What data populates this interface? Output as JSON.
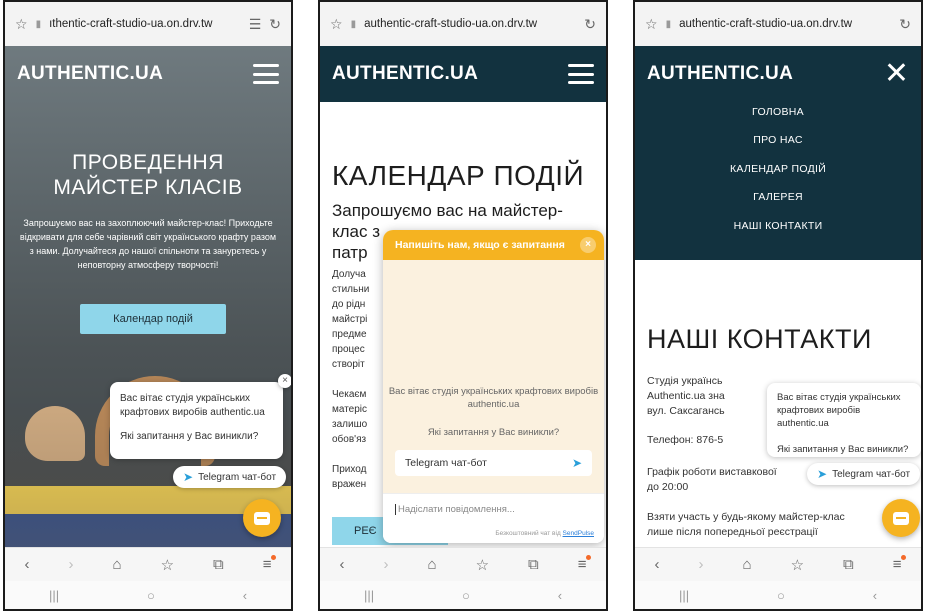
{
  "browser": {
    "url_p1": "ıthentic-craft-studio-ua.on.drv.tw",
    "url": "authentic-craft-studio-ua.on.drv.tw"
  },
  "site": {
    "logo": "AUTHENTIC.UA"
  },
  "hero": {
    "title_line1": "ПРОВЕДЕННЯ",
    "title_line2": "МАЙСТЕР КЛАСІВ",
    "text": "Запрошуємо вас на захоплюючий майстер-клас! Приходьте відкривати для себе чарівний світ українського крафту разом з нами. Долучайтеся до нашої спільноти та занурєтесь у неповторну атмосферу творчості!",
    "button": "Календар подій"
  },
  "bot": {
    "greeting": "Вас вітає студія українських крафтових виробів authentic.ua",
    "question": "Які запитання у Вас виникли?",
    "telegram": "Telegram чат-бот",
    "close": "×"
  },
  "events": {
    "title": "КАЛЕНДАР ПОДІЙ",
    "subtitle_1": "Запрошуємо вас на майстер-",
    "subtitle_2": "клас з",
    "subtitle_3": "патр",
    "body": [
      "Долуча",
      "стильни",
      "до рідн",
      "майстрі",
      "предме",
      "процес",
      "створіт",
      "",
      "Чекаєм",
      "матеріс",
      "залишо",
      "обов'яз",
      "",
      "Приход",
      "вражен"
    ],
    "button": "РЕЄ"
  },
  "chat": {
    "header": "Напишіть нам, якщо є запитання",
    "close": "×",
    "placeholder": "Надіслати повідомлення...",
    "powered_prefix": "Безкоштовний чат від ",
    "powered_link": "SendPulse"
  },
  "menu": {
    "items": [
      "ГОЛОВНА",
      "ПРО НАС",
      "КАЛЕНДАР ПОДІЙ",
      "ГАЛЕРЕЯ",
      "НАШІ КОНТАКТИ"
    ]
  },
  "contacts": {
    "title": "НАШІ КОНТАКТИ",
    "line1": "Студія українсь",
    "line2": "Authentic.ua зна",
    "line3": "вул. Саксагансь",
    "phone": "Телефон: 876-5",
    "hours1": "Графік роботи виставкової",
    "hours2": "до 20:00",
    "join1": "Взяти участь у будь-якому майстер-клас",
    "join2": "лише після попередньої реєстрації"
  },
  "icons": {
    "star": "☆",
    "lock": "▮",
    "reload": "↻",
    "reader": "☰",
    "back": "‹",
    "forward": "›",
    "home": "⌂",
    "bookmark": "☆",
    "tabs": "⧉",
    "menu": "≡",
    "sys_recent": "|||",
    "sys_home": "○",
    "sys_back": "‹",
    "send": "➤"
  },
  "colors": {
    "brand_dark": "#12323f",
    "accent_blue": "#8fd6ea",
    "chat_orange": "#f5b321",
    "telegram_blue": "#2a9fd9"
  }
}
